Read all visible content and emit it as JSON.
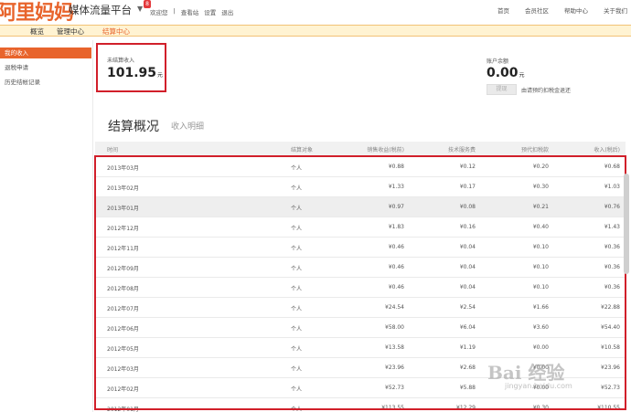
{
  "header": {
    "logo": "阿里妈妈",
    "platform": "媒体流量平台",
    "badge": "8",
    "left_links": [
      "欢迎您",
      "|",
      "查看站",
      "设置",
      "退出"
    ],
    "right_links": [
      "首页",
      "会员社区",
      "帮助中心",
      "关于我们"
    ]
  },
  "nav": {
    "tabs": [
      "概览",
      "管理中心",
      "结算中心"
    ],
    "active_index": 2
  },
  "sidebar": {
    "items": [
      "我的收入",
      "退税申请",
      "历史结帐记录"
    ],
    "active_index": 0
  },
  "summary": {
    "pending_label": "未结算收入",
    "pending_value": "101.95",
    "pending_unit": "元",
    "balance_label": "账户余额",
    "balance_value": "0.00",
    "balance_unit": "元",
    "withdraw_button": "提现",
    "withdraw_note": "由请预约扣税金退还"
  },
  "section": {
    "title": "结算概况",
    "tab2": "收入明细"
  },
  "table": {
    "headers": [
      "时间",
      "结算对象",
      "销售收益(税前)",
      "技术服务费",
      "预代扣税款",
      "收入(税后)"
    ],
    "rows": [
      {
        "time": "2013年03月",
        "target": "个人",
        "sales": "¥0.88",
        "tech": "¥0.12",
        "tax": "¥0.20",
        "income": "¥0.68"
      },
      {
        "time": "2013年02月",
        "target": "个人",
        "sales": "¥1.33",
        "tech": "¥0.17",
        "tax": "¥0.30",
        "income": "¥1.03"
      },
      {
        "time": "2013年01月",
        "target": "个人",
        "sales": "¥0.97",
        "tech": "¥0.08",
        "tax": "¥0.21",
        "income": "¥0.76"
      },
      {
        "time": "2012年12月",
        "target": "个人",
        "sales": "¥1.83",
        "tech": "¥0.16",
        "tax": "¥0.40",
        "income": "¥1.43"
      },
      {
        "time": "2012年11月",
        "target": "个人",
        "sales": "¥0.46",
        "tech": "¥0.04",
        "tax": "¥0.10",
        "income": "¥0.36"
      },
      {
        "time": "2012年09月",
        "target": "个人",
        "sales": "¥0.46",
        "tech": "¥0.04",
        "tax": "¥0.10",
        "income": "¥0.36"
      },
      {
        "time": "2012年08月",
        "target": "个人",
        "sales": "¥0.46",
        "tech": "¥0.04",
        "tax": "¥0.10",
        "income": "¥0.36"
      },
      {
        "time": "2012年07月",
        "target": "个人",
        "sales": "¥24.54",
        "tech": "¥2.54",
        "tax": "¥1.66",
        "income": "¥22.88"
      },
      {
        "time": "2012年06月",
        "target": "个人",
        "sales": "¥58.00",
        "tech": "¥6.04",
        "tax": "¥3.60",
        "income": "¥54.40"
      },
      {
        "time": "2012年05月",
        "target": "个人",
        "sales": "¥13.58",
        "tech": "¥1.19",
        "tax": "¥0.00",
        "income": "¥10.58"
      },
      {
        "time": "2012年03月",
        "target": "个人",
        "sales": "¥23.96",
        "tech": "¥2.68",
        "tax": "¥0.00",
        "income": "¥23.96"
      },
      {
        "time": "2012年02月",
        "target": "个人",
        "sales": "¥52.73",
        "tech": "¥5.88",
        "tax": "¥0.00",
        "income": "¥52.73"
      },
      {
        "time": "2012年01月",
        "target": "个人",
        "sales": "¥113.55",
        "tech": "¥12.29",
        "tax": "¥0.30",
        "income": "¥110.55"
      }
    ],
    "highlight_index": 2
  },
  "watermark": {
    "main": "Bai 经验",
    "sub": "jingyan.baidu.com"
  },
  "colors": {
    "accent": "#e8642c",
    "nav_bg": "#fff3d2",
    "highlight_box": "#d11f2a"
  }
}
